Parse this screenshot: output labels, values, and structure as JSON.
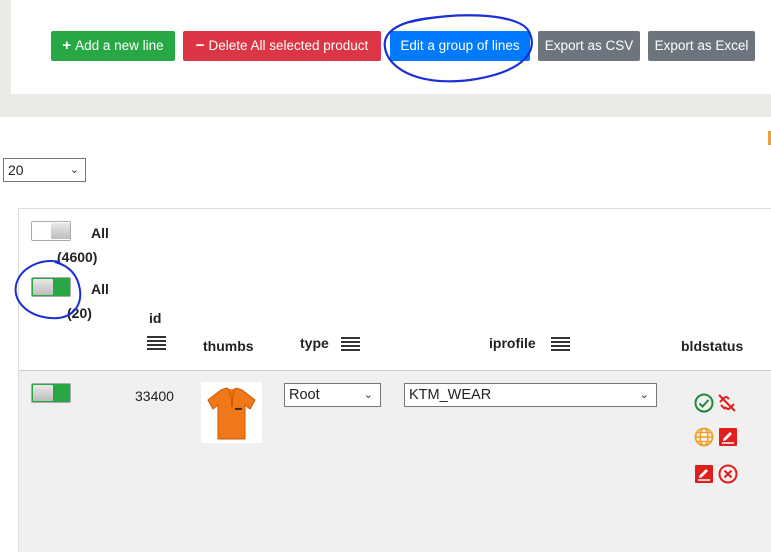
{
  "toolbar": {
    "add_label": "Add a new line",
    "delete_label": "Delete All selected product",
    "edit_group_label": "Edit a group of lines",
    "export_csv_label": "Export as CSV",
    "export_excel_label": "Export as Excel"
  },
  "page_size": {
    "value": "20"
  },
  "filters": {
    "all_total_label": "All",
    "all_total_count": "(4600)",
    "all_page_label": "All",
    "all_page_count": "(20)"
  },
  "columns": {
    "id": "id",
    "thumbs": "thumbs",
    "type": "type",
    "iprofile": "iprofile",
    "bldstatus": "bldstatus"
  },
  "rows": [
    {
      "id": "33400",
      "type": "Root",
      "iprofile": "KTM_WEAR",
      "status_icons": [
        "check-circle-icon",
        "unlink-icon",
        "globe-icon",
        "edit-icon",
        "edit-icon",
        "cancel-circle-icon"
      ]
    }
  ],
  "colors": {
    "green": "#28a745",
    "red": "#dc3545",
    "blue": "#007bff",
    "gray": "#6c757d",
    "annotation": "#1a2fd6"
  }
}
